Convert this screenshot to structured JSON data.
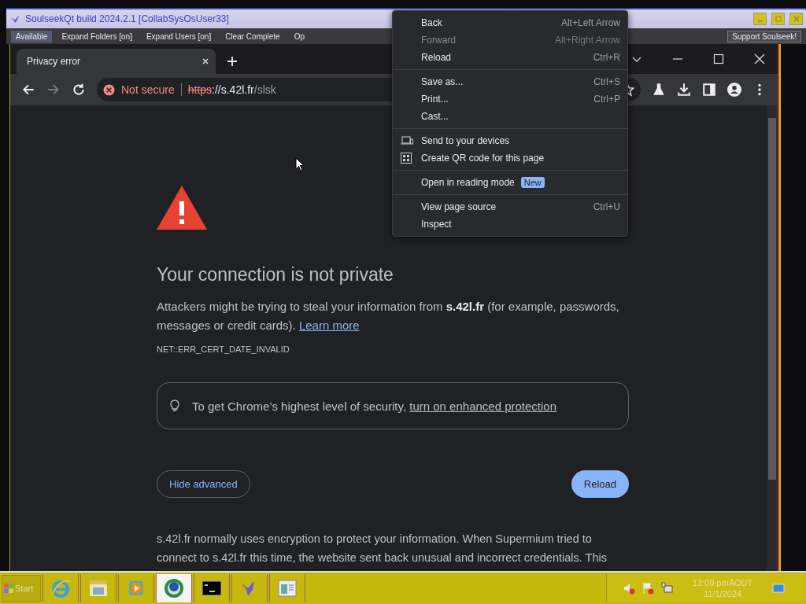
{
  "soulseek": {
    "title": "SoulseekQt build 2024.2.1 [CollabSysOsUser33]",
    "toolbar": [
      "Available",
      "Expand Folders [on]",
      "Expand Users [on]",
      "Clear Complete",
      "Op"
    ],
    "support_button": "Support Soulseek!"
  },
  "browser": {
    "tabs": [
      {
        "label": "Privacy error",
        "selected": true
      }
    ],
    "nav": [
      {
        "kind": "back",
        "disabled": false
      },
      {
        "kind": "forward",
        "disabled": true
      },
      {
        "kind": "reload",
        "disabled": false
      }
    ],
    "address": {
      "security": "Not secure",
      "scheme": "https",
      "host": "://s.42l.fr",
      "path": "/slsk"
    }
  },
  "page": {
    "heading": "Your connection is not private",
    "intro": "Attackers might be trying to steal your information from **s.42l.fr** (for example, passwords, messages or credit cards).",
    "learn_more": "Learn more",
    "error_code": "NET::ERR_CERT_DATE_INVALID",
    "tip": "To get Chrome’s highest level of security,",
    "tip_link": "turn on enhanced protection",
    "secondary_button": "Hide advanced",
    "primary_button": "Reload",
    "details": "s.42l.fr normally uses encryption to protect your information. When Supermium tried to connect to s.42l.fr this time, the website sent back unusual and incorrect credentials. This"
  },
  "context_menu": {
    "groups": [
      [
        {
          "label": "Back",
          "shortcut": "Alt+Left Arrow",
          "disabled": false
        },
        {
          "label": "Forward",
          "shortcut": "Alt+Right Arrow",
          "disabled": true
        },
        {
          "label": "Reload",
          "shortcut": "Ctrl+R",
          "disabled": false
        }
      ],
      [
        {
          "label": "Save as...",
          "shortcut": "Ctrl+S",
          "disabled": false
        },
        {
          "label": "Print...",
          "shortcut": "Ctrl+P",
          "disabled": false
        },
        {
          "label": "Cast...",
          "disabled": false
        }
      ],
      [
        {
          "label": "Send to your devices",
          "kind": "devices",
          "disabled": false
        },
        {
          "label": "Create QR code for this page",
          "kind": "qr",
          "disabled": false
        }
      ],
      [
        {
          "label": "Open in reading mode",
          "badge": "New",
          "disabled": false
        }
      ],
      [
        {
          "label": "View page source",
          "shortcut": "Ctrl+U",
          "disabled": false
        },
        {
          "label": "Inspect",
          "disabled": false
        }
      ]
    ]
  },
  "taskbar": {
    "start": "Start",
    "apps": [
      {
        "kind": "ie",
        "selected": false
      },
      {
        "kind": "explorer",
        "selected": false
      },
      {
        "kind": "media",
        "selected": false
      },
      {
        "kind": "globe",
        "selected": true
      },
      {
        "kind": "cmd",
        "selected": false
      },
      {
        "kind": "bird",
        "selected": false
      },
      {
        "kind": "window",
        "selected": false
      }
    ],
    "time": "13:09 pmÄÖÜT",
    "date": "11/1/2024"
  }
}
